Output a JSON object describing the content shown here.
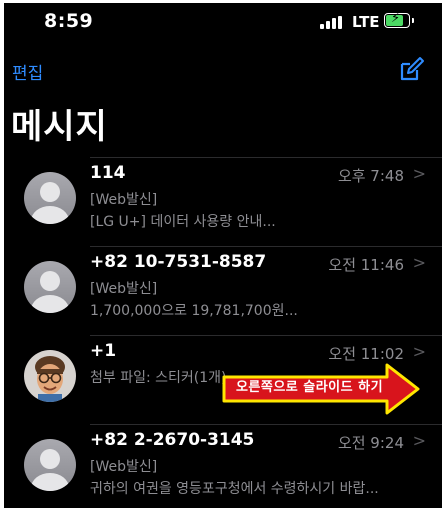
{
  "status": {
    "time": "8:59",
    "network": "LTE",
    "battery_level": 0.85
  },
  "nav": {
    "edit_label": "편집",
    "title": "메시지"
  },
  "messages": [
    {
      "sender": "114",
      "time": "오후 7:48",
      "line1": "[Web발신]",
      "line2": "[LG U+] 데이터 사용량 안내..."
    },
    {
      "sender": "+82 10-7531-8587",
      "time": "오전 11:46",
      "line1": "[Web발신]",
      "line2": "1,700,000으로 19,781,700원..."
    },
    {
      "sender": "+1",
      "time": "오전 11:02",
      "line1": "첨부 파일: 스티커(1개)",
      "line2": ""
    },
    {
      "sender": "+82 2-2670-3145",
      "time": "오전 9:24",
      "line1": "[Web발신]",
      "line2": "귀하의 여권을 영등포구청에서 수령하시기 바랍..."
    }
  ],
  "annotation": {
    "text": "오른쪽으로 슬라이드 하기",
    "fill": "#d8141c",
    "border": "#ffe600"
  },
  "colors": {
    "accent": "#2f8cff",
    "background": "#000000",
    "secondary_text": "#8e8e93"
  }
}
